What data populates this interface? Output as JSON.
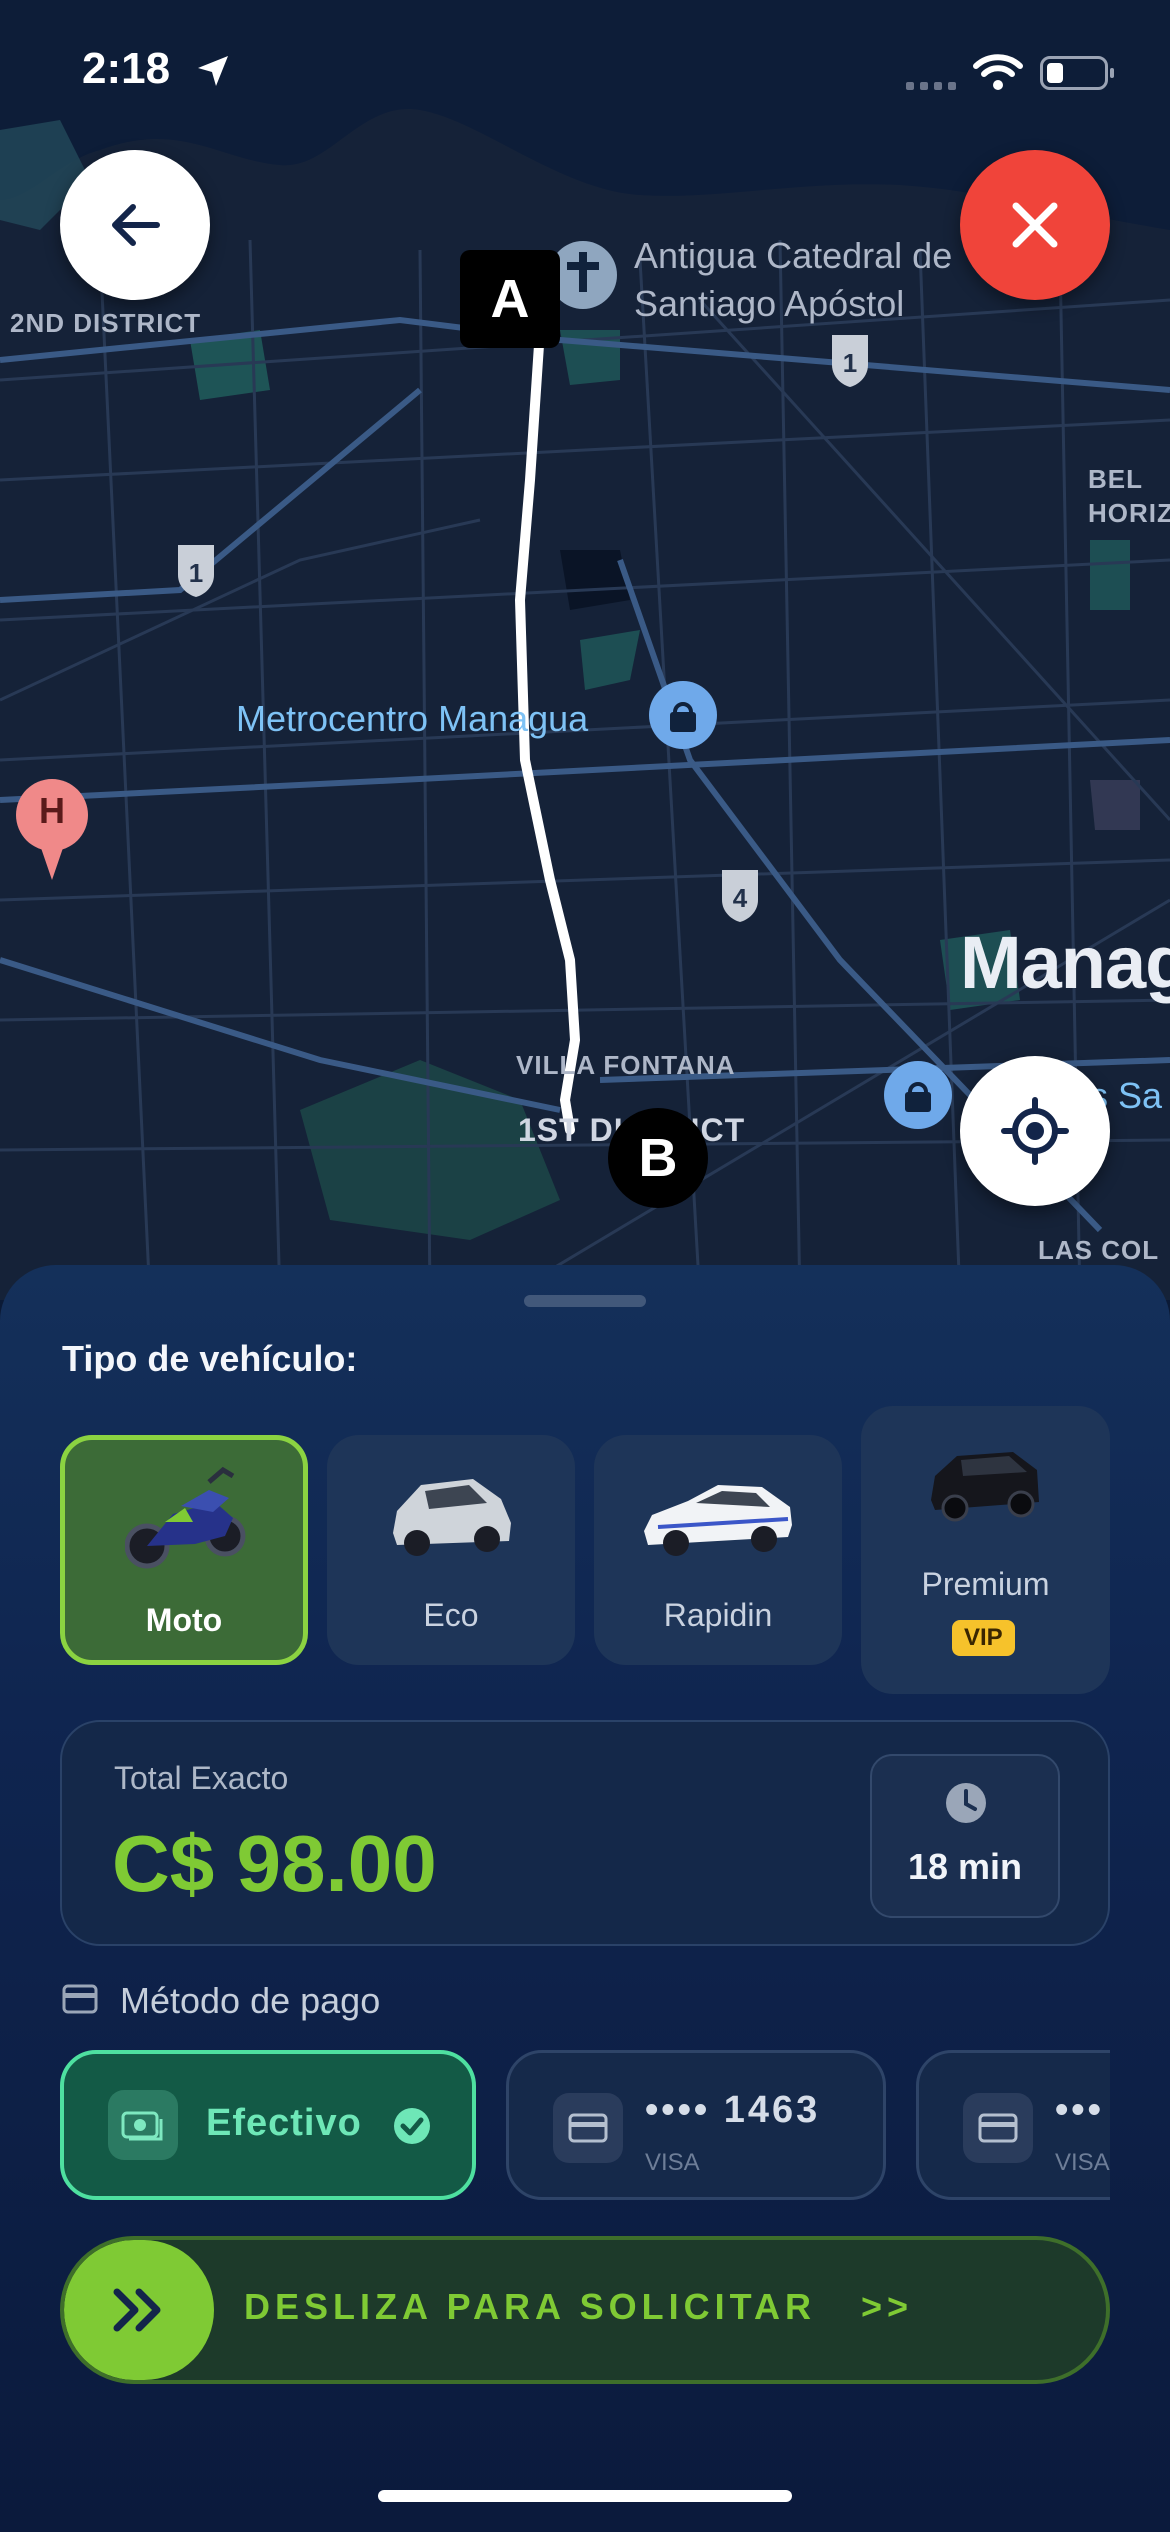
{
  "status_bar": {
    "time": "2:18"
  },
  "map": {
    "labels": {
      "district_2": "2ND DISTRICT",
      "district_1": "1ST DISTRICT",
      "villa_fontana": "VILLA FONTANA",
      "las_colinas": "LAS COL",
      "bel_horiz": "BEL\nHORIZ",
      "city": "Manag",
      "poi_cathedral": "Antigua Catedral de\nSantiago Apóstol",
      "poi_metrocentro": "Metrocentro Managua",
      "poi_partial": "s Sa",
      "hospital": "H",
      "route_shield_1a": "1",
      "route_shield_1b": "1",
      "route_shield_4": "4"
    },
    "markers": {
      "start": "A",
      "end": "B"
    }
  },
  "sheet": {
    "vehicle_title": "Tipo de vehículo:",
    "vehicles": [
      {
        "label": "Moto",
        "selected": true
      },
      {
        "label": "Eco",
        "selected": false
      },
      {
        "label": "Rapidin",
        "selected": false
      },
      {
        "label": "Premium",
        "badge": "VIP",
        "selected": false
      }
    ],
    "total": {
      "label": "Total Exacto",
      "amount": "C$ 98.00",
      "time": "18 min"
    },
    "payment_title": "Método de pago",
    "payment_methods": [
      {
        "label": "Efectivo",
        "selected": true
      },
      {
        "masked": "•••• 1463",
        "brand": "VISA",
        "selected": false
      },
      {
        "masked": "•••",
        "brand": "VISA",
        "selected": false
      }
    ],
    "slider_label": "DESLIZA PARA SOLICITAR   >>"
  },
  "colors": {
    "accent_green": "#7fca34",
    "cancel_red": "#f0443a",
    "sheet_bg": "#0f2550",
    "map_bg": "#152238"
  }
}
